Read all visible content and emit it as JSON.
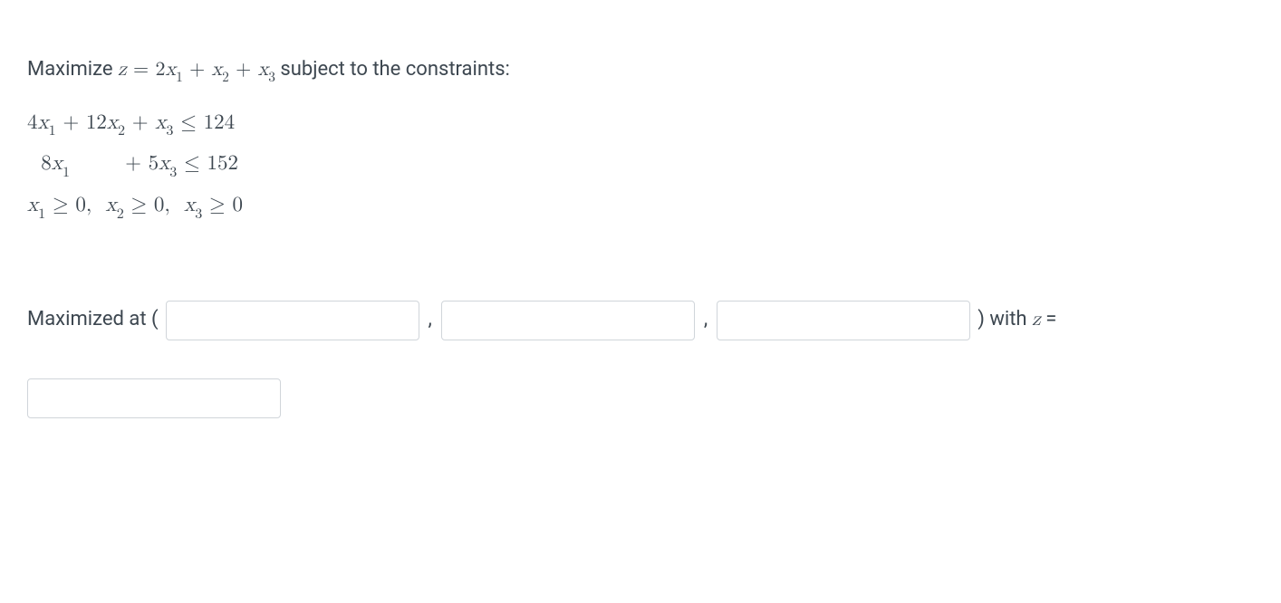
{
  "problem": {
    "intro": "Maximize ",
    "objective_var": "z",
    "equals": " = ",
    "objective_expr": "2x₁ + x₂ + x₃",
    "subject": " subject to the constraints:"
  },
  "constraints": {
    "c1": "4x₁ + 12x₂ + x₃ ≤ 124",
    "c2_lhs": "8x₁",
    "c2_rhs": "+ 5x₃ ≤ 152",
    "c3": "x₁ ≥ 0,  x₂ ≥ 0,  x₃ ≥ 0"
  },
  "answer": {
    "maximized_label": "Maximized at (",
    "comma": ",",
    "close_paren": ") with ",
    "z_var": "z",
    "equals": " ="
  },
  "inputs": {
    "x1": "",
    "x2": "",
    "x3": "",
    "z": ""
  }
}
